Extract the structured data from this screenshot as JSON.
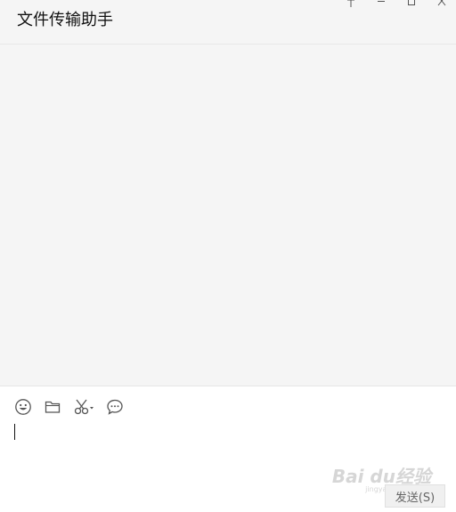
{
  "window": {
    "title": "文件传输助手",
    "controls": [
      {
        "name": "pin-icon"
      },
      {
        "name": "minimize-icon"
      },
      {
        "name": "maximize-icon"
      },
      {
        "name": "close-icon"
      }
    ]
  },
  "toolbar": {
    "tools": [
      {
        "name": "emoji-icon"
      },
      {
        "name": "folder-icon"
      },
      {
        "name": "scissors-icon"
      },
      {
        "name": "chat-history-icon"
      }
    ]
  },
  "composer": {
    "value": "",
    "send_label": "发送(S)"
  },
  "watermark": {
    "brand": "Bai du经验",
    "url": "jingyan.baidu.com"
  },
  "colors": {
    "background": "#f5f5f5",
    "composer": "#ffffff",
    "send_button_bg": "#f0f0f0",
    "send_button_text": "#666666"
  }
}
